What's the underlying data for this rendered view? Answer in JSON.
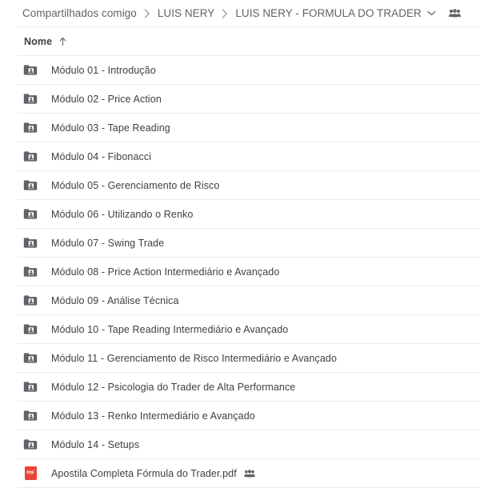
{
  "breadcrumb": {
    "items": [
      {
        "label": "Compartilhados comigo",
        "icon": ""
      },
      {
        "label": "LUIS NERY",
        "icon": ""
      },
      {
        "label": "LUIS NERY - FORMULA DO TRADER",
        "icon": ""
      }
    ],
    "separator_icon": "chevron-right-icon",
    "caret_icon": "chevron-down-icon",
    "shared_icon": "people-shared-icon"
  },
  "column_header": {
    "name_label": "Nome",
    "sort_icon": "arrow-up-icon",
    "sort_direction": "ascending"
  },
  "files": [
    {
      "name": "Módulo 01 - Introdução",
      "icon": "shared-folder-icon",
      "type": "folder",
      "shared": false
    },
    {
      "name": "Módulo 02 - Price Action",
      "icon": "shared-folder-icon",
      "type": "folder",
      "shared": false
    },
    {
      "name": "Módulo 03 - Tape Reading",
      "icon": "shared-folder-icon",
      "type": "folder",
      "shared": false
    },
    {
      "name": "Módulo 04 - Fibonacci",
      "icon": "shared-folder-icon",
      "type": "folder",
      "shared": false
    },
    {
      "name": "Módulo 05 - Gerenciamento de Risco",
      "icon": "shared-folder-icon",
      "type": "folder",
      "shared": false
    },
    {
      "name": "Módulo 06 - Utilizando o Renko",
      "icon": "shared-folder-icon",
      "type": "folder",
      "shared": false
    },
    {
      "name": "Módulo 07 - Swing Trade",
      "icon": "shared-folder-icon",
      "type": "folder",
      "shared": false
    },
    {
      "name": "Módulo 08 - Price Action Intermediário e Avançado",
      "icon": "shared-folder-icon",
      "type": "folder",
      "shared": false
    },
    {
      "name": "Módulo 09 - Análise Técnica",
      "icon": "shared-folder-icon",
      "type": "folder",
      "shared": false
    },
    {
      "name": "Módulo 10 - Tape Reading Intermediário e Avançado",
      "icon": "shared-folder-icon",
      "type": "folder",
      "shared": false
    },
    {
      "name": "Módulo 11 - Gerenciamento de Risco Intermediário e Avançado",
      "icon": "shared-folder-icon",
      "type": "folder",
      "shared": false
    },
    {
      "name": "Módulo 12 - Psicologia do Trader de Alta Performance",
      "icon": "shared-folder-icon",
      "type": "folder",
      "shared": false
    },
    {
      "name": "Módulo 13 - Renko Intermediário e Avançado",
      "icon": "shared-folder-icon",
      "type": "folder",
      "shared": false
    },
    {
      "name": "Módulo 14 - Setups",
      "icon": "shared-folder-icon",
      "type": "folder",
      "shared": false
    },
    {
      "name": "Apostila Completa Fórmula do Trader.pdf",
      "icon": "pdf-file-icon",
      "type": "pdf",
      "shared": true,
      "badge_text": "PDF"
    }
  ],
  "colors": {
    "text_primary": "#3c4043",
    "text_secondary": "#5f6368",
    "divider": "#e8eaed",
    "folder_icon": "#5f6368",
    "pdf_red": "#ea4335",
    "background": "#ffffff"
  }
}
